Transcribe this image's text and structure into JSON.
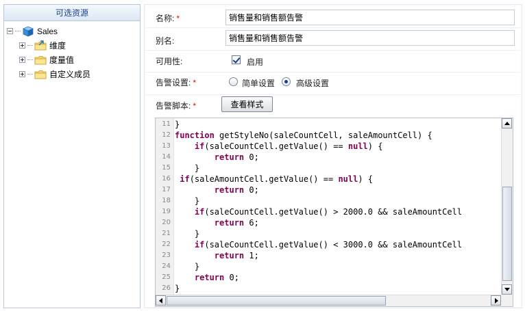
{
  "left_panel": {
    "title": "可选资源",
    "tree": {
      "root": {
        "label": "Sales",
        "icon": "cube-icon"
      },
      "children": [
        {
          "label": "维度",
          "icon": "dimension-folder-icon"
        },
        {
          "label": "度量值",
          "icon": "folder-icon"
        },
        {
          "label": "自定义成员",
          "icon": "folder-icon"
        }
      ]
    }
  },
  "form": {
    "name": {
      "label": "名称:",
      "required": "*",
      "value": "销售量和销售额告警"
    },
    "alias": {
      "label": "别名:",
      "value": "销售量和销售额告警"
    },
    "availability": {
      "label": "可用性:",
      "checkbox_label": "启用",
      "checked": true
    },
    "alert_setting": {
      "label": "告警设置:",
      "required": "*",
      "options": [
        {
          "label": "简单设置",
          "selected": false
        },
        {
          "label": "高级设置",
          "selected": true
        }
      ]
    },
    "alert_script": {
      "label": "告警脚本:",
      "required": "*",
      "button_label": "查看样式"
    }
  },
  "code_editor": {
    "lines": [
      {
        "num": "11",
        "text": "}"
      },
      {
        "num": "12",
        "text": "function getStyleNo(saleCountCell, saleAmountCell) {"
      },
      {
        "num": "13",
        "text": "    if(saleCountCell.getValue() == null) {"
      },
      {
        "num": "14",
        "text": "        return 0;"
      },
      {
        "num": "15",
        "text": "    }"
      },
      {
        "num": "16",
        "text": " if(saleAmountCell.getValue() == null) {"
      },
      {
        "num": "17",
        "text": "        return 0;"
      },
      {
        "num": "18",
        "text": "    }"
      },
      {
        "num": "19",
        "text": "    if(saleCountCell.getValue() > 2000.0 && saleAmountCell"
      },
      {
        "num": "20",
        "text": "        return 6;"
      },
      {
        "num": "21",
        "text": "    }"
      },
      {
        "num": "22",
        "text": "    if(saleCountCell.getValue() < 3000.0 && saleAmountCell"
      },
      {
        "num": "23",
        "text": "        return 1;"
      },
      {
        "num": "24",
        "text": "    }"
      },
      {
        "num": "25",
        "text": "    return 0;"
      },
      {
        "num": "26",
        "text": "}"
      }
    ],
    "keywords": [
      "function",
      "if",
      "null",
      "return"
    ],
    "keyword_color": "#7f0055"
  },
  "colors": {
    "panel_title": "#15428b",
    "border": "#b8c8de",
    "required": "#e00000"
  }
}
